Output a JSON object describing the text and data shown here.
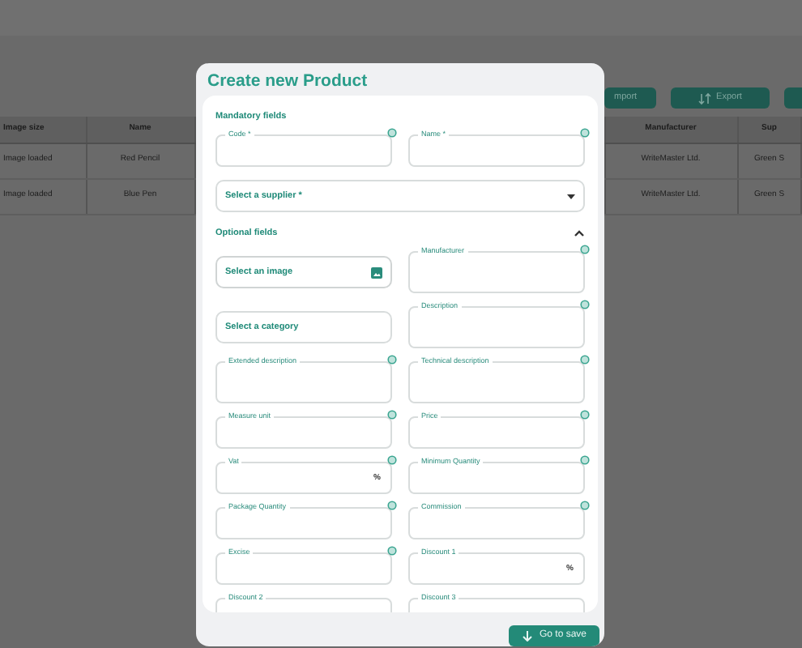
{
  "background": {
    "toolbar": [
      {
        "label": "mport",
        "icon": false
      },
      {
        "label": "Export",
        "icon": true
      },
      {
        "icon": false
      }
    ],
    "table": {
      "columns": [
        "Image size",
        "Name",
        "",
        "Manufacturer",
        "Sup"
      ],
      "rows": [
        [
          "Image loaded",
          "Red Pencil",
          "",
          "WriteMaster Ltd.",
          "Green S"
        ],
        [
          "Image loaded",
          "Blue Pen",
          "",
          "WriteMaster Ltd.",
          "Green S"
        ]
      ]
    }
  },
  "dialog": {
    "title": "Create new Product",
    "sections": [
      {
        "title": "Mandatory fields",
        "fields": [
          {
            "kind": "text",
            "label": "Code *",
            "info": true
          },
          {
            "kind": "text",
            "label": "Name *",
            "info": true
          },
          {
            "kind": "dropdown",
            "label": "Select a supplier *"
          }
        ]
      },
      {
        "title": "Optional fields",
        "expanded": true,
        "fields": [
          {
            "kind": "image-picker",
            "label": "Select an image"
          },
          {
            "kind": "picker",
            "label": "Select a category"
          },
          {
            "kind": "textarea",
            "label": "Extended description",
            "info": true
          },
          {
            "kind": "text",
            "label": "Measure unit",
            "info": true
          },
          {
            "kind": "text",
            "label": "Vat",
            "info": true,
            "suffix": "%"
          },
          {
            "kind": "text",
            "label": "Package Quantity",
            "info": true
          },
          {
            "kind": "text",
            "label": "Excise",
            "info": true
          },
          {
            "kind": "text",
            "label": "Discount 2",
            "info": false
          },
          {
            "kind": "textarea",
            "label": "Manufacturer",
            "info": true
          },
          {
            "kind": "textarea",
            "label": "Description",
            "info": true
          },
          {
            "kind": "textarea",
            "label": "Technical description",
            "info": true
          },
          {
            "kind": "text",
            "label": "Price",
            "info": true
          },
          {
            "kind": "text",
            "label": "Minimum Quantity",
            "info": true
          },
          {
            "kind": "text",
            "label": "Commission",
            "info": true
          },
          {
            "kind": "text",
            "label": "Discount 1",
            "info": false,
            "suffix": "%"
          },
          {
            "kind": "text",
            "label": "Discount 3",
            "info": false
          }
        ]
      }
    ],
    "footer_button": "Go to save"
  }
}
